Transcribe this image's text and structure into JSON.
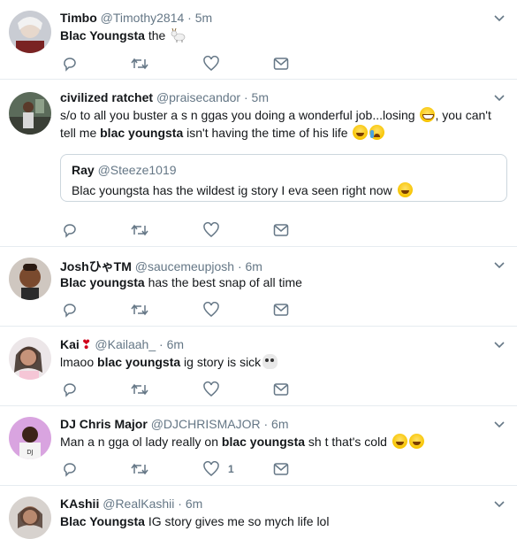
{
  "colors": {
    "text": "#14171a",
    "muted": "#657786",
    "divider": "#e6ecf0",
    "quote_border": "#ccd6dd"
  },
  "icons": [
    "reply-icon",
    "retweet-icon",
    "like-icon",
    "dm-icon",
    "caret-down-icon"
  ],
  "tweets": [
    {
      "name": "Timbo",
      "handle": "@Timothy2814",
      "dot": "·",
      "time": "5m",
      "text": [
        {
          "t": "Blac Youngsta",
          "b": true
        },
        {
          "t": " the",
          "b": false
        }
      ],
      "emoji": [
        "goat"
      ]
    },
    {
      "name": "civilized ratchet",
      "handle": "@praisecandor",
      "dot": "·",
      "time": "5m",
      "line1a": "s/o to all you buster a  s n  ggas you doing a wonderful job...losing",
      "line1b": ", you can't",
      "line2a": "tell me ",
      "line2b": "blac youngsta",
      "line2c": " isn't having the time of his life",
      "quote": {
        "name": "Ray",
        "handle": "@Steeze1019",
        "text": "Blac youngsta has the wildest ig story I eva seen right now"
      }
    },
    {
      "name": "JoshひゃTM",
      "handle": "@saucemeupjosh",
      "dot": "·",
      "time": "6m",
      "text": [
        {
          "t": "Blac youngsta",
          "b": true
        },
        {
          "t": " has the best snap of all time",
          "b": false
        }
      ]
    },
    {
      "name": "Kai",
      "handle": "@Kailaah_",
      "dot": "·",
      "time": "6m",
      "text": [
        {
          "t": "lmaoo ",
          "b": false
        },
        {
          "t": "blac youngsta",
          "b": true
        },
        {
          "t": " ig story is sick",
          "b": false
        }
      ]
    },
    {
      "name": "DJ Chris Major",
      "handle": "@DJCHRISMAJOR",
      "dot": "·",
      "time": "6m",
      "text": [
        {
          "t": "Man a n  gga ol lady really on ",
          "b": false
        },
        {
          "t": "blac youngsta",
          "b": true
        },
        {
          "t": " sh  t that's cold",
          "b": false
        }
      ],
      "like_count": "1"
    },
    {
      "name": "KAshii",
      "handle": "@RealKashii",
      "dot": "·",
      "time": "6m",
      "text": [
        {
          "t": "Blac Youngsta",
          "b": true
        },
        {
          "t": " IG story gives me so mych life lol",
          "b": false
        }
      ]
    }
  ]
}
